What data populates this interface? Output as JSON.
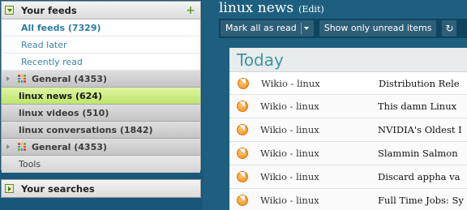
{
  "sidebar": {
    "feeds_header": "Your feeds",
    "add_label": "+",
    "views": [
      {
        "label": "All feeds (7329)"
      },
      {
        "label": "Read later"
      },
      {
        "label": "Recently read"
      }
    ],
    "folders": [
      {
        "label": "General (4353)"
      },
      {
        "label": "linux news (624)"
      },
      {
        "label": "linux videos (510)"
      },
      {
        "label": "linux conversations (1842)"
      },
      {
        "label": "General (4353)"
      }
    ],
    "tools_label": "Tools",
    "searches_header": "Your searches"
  },
  "main": {
    "title": "linux news",
    "edit_label": "(Edit)",
    "toolbar": {
      "mark_all_read": "Mark all as read",
      "show_unread": "Show only unread items",
      "refresh_icon": "↻"
    },
    "section_label": "Today",
    "entries": [
      {
        "source": "Wikio - linux",
        "title": "Distribution Rele"
      },
      {
        "source": "Wikio - linux",
        "title": "This damn Linux"
      },
      {
        "source": "Wikio - linux",
        "title": "NVIDIA's Oldest I"
      },
      {
        "source": "Wikio - linux",
        "title": "Slammin Salmon"
      },
      {
        "source": "Wikio - linux",
        "title": "Discard appha va"
      },
      {
        "source": "Wikio - linux",
        "title": "Full Time Jobs: Sy"
      }
    ]
  },
  "icons": {
    "feed": "rss-icon",
    "folder_grid_colors": [
      "#e94b3c",
      "#f6c342",
      "#6cb33f",
      "#3d8fd8",
      "#f6c342",
      "#e94b3c",
      "#6cb33f",
      "#3d8fd8",
      "#e94b3c"
    ]
  }
}
